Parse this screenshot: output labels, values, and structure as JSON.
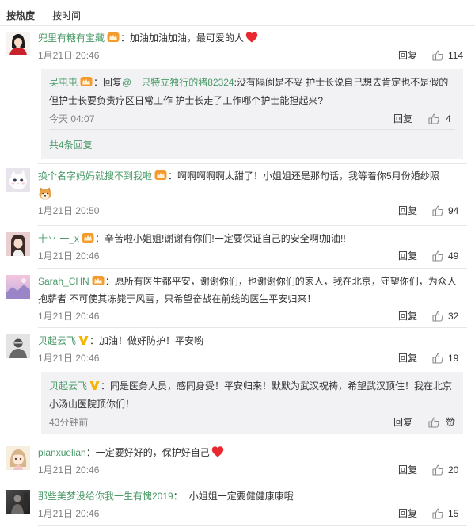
{
  "tabs": [
    {
      "label": "按热度",
      "active": true
    },
    {
      "label": "按时间",
      "active": false
    }
  ],
  "name_separator": "：",
  "reply_label": "回复",
  "colors": {
    "link": "#4a9a68",
    "text": "#333333",
    "muted": "#808080",
    "reply_bg": "#f2f2f5",
    "divider": "#e6e6e6"
  },
  "comments": [
    {
      "user": "兜里有糖有宝藏",
      "badge": "fan-badge-icon",
      "text": "加油加油加油，最可爱的人",
      "emoji": "red-heart-icon",
      "time": "1月21日 20:46",
      "likes": 114,
      "replies": [
        {
          "user": "吴屯屯",
          "badge": "fan-badge-icon",
          "prefix": "回复",
          "mention": "@一只特立独行的猪82324",
          "text": ":没有隔阂是不妥 护士长说自己想去肯定也不是假的 但护士长要负责疗区日常工作 护士长走了工作哪个护士能担起来?",
          "time": "今天 04:07",
          "likes": 4
        }
      ],
      "more_replies": "共4条回复"
    },
    {
      "user": "换个名字妈妈就搜不到我啦",
      "badge": "fan-badge-icon",
      "text": "啊啊啊啊啊太甜了！小姐姐还是那句话，我等着你5月份婚纱照",
      "emoji": "shiba-dog-icon",
      "time": "1月21日 20:50",
      "likes": 94
    },
    {
      "user": "十丷 一_x",
      "badge": "fan-badge-icon",
      "text": "辛苦啦小姐姐!谢谢有你们!一定要保证自己的安全啊!加油!!",
      "time": "1月21日 20:46",
      "likes": 49
    },
    {
      "user": "Sarah_CHN",
      "badge": "fan-badge-icon",
      "text": "愿所有医生都平安，谢谢你们，也谢谢你们的家人，我在北京，守望你们，为众人抱薪者 不可使其冻毙于风雪，只希望奋战在前线的医生平安归来！",
      "time": "1月21日 20:46",
      "likes": 32
    },
    {
      "user": "贝起云飞",
      "badge": "verified-v-icon",
      "text": "加油！做好防护！平安哟",
      "time": "1月21日 20:46",
      "likes": 19,
      "replies": [
        {
          "user": "贝起云飞",
          "badge": "verified-v-icon",
          "text": "同是医务人员，感同身受！平安归来！默默为武汉祝祷，希望武汉顶住！我在北京小汤山医院顶你们！",
          "time": "43分钟前",
          "likes": "赞"
        }
      ]
    },
    {
      "user": "pianxuelian",
      "text": "一定要好好的，保护好自己",
      "emoji": "red-heart-icon",
      "time": "1月21日 20:46",
      "likes": 20
    },
    {
      "user": "那些美梦没给你我一生有愧2019",
      "text": "小姐姐一定要健健康康哦",
      "time": "1月21日 20:46",
      "likes": 15
    }
  ]
}
